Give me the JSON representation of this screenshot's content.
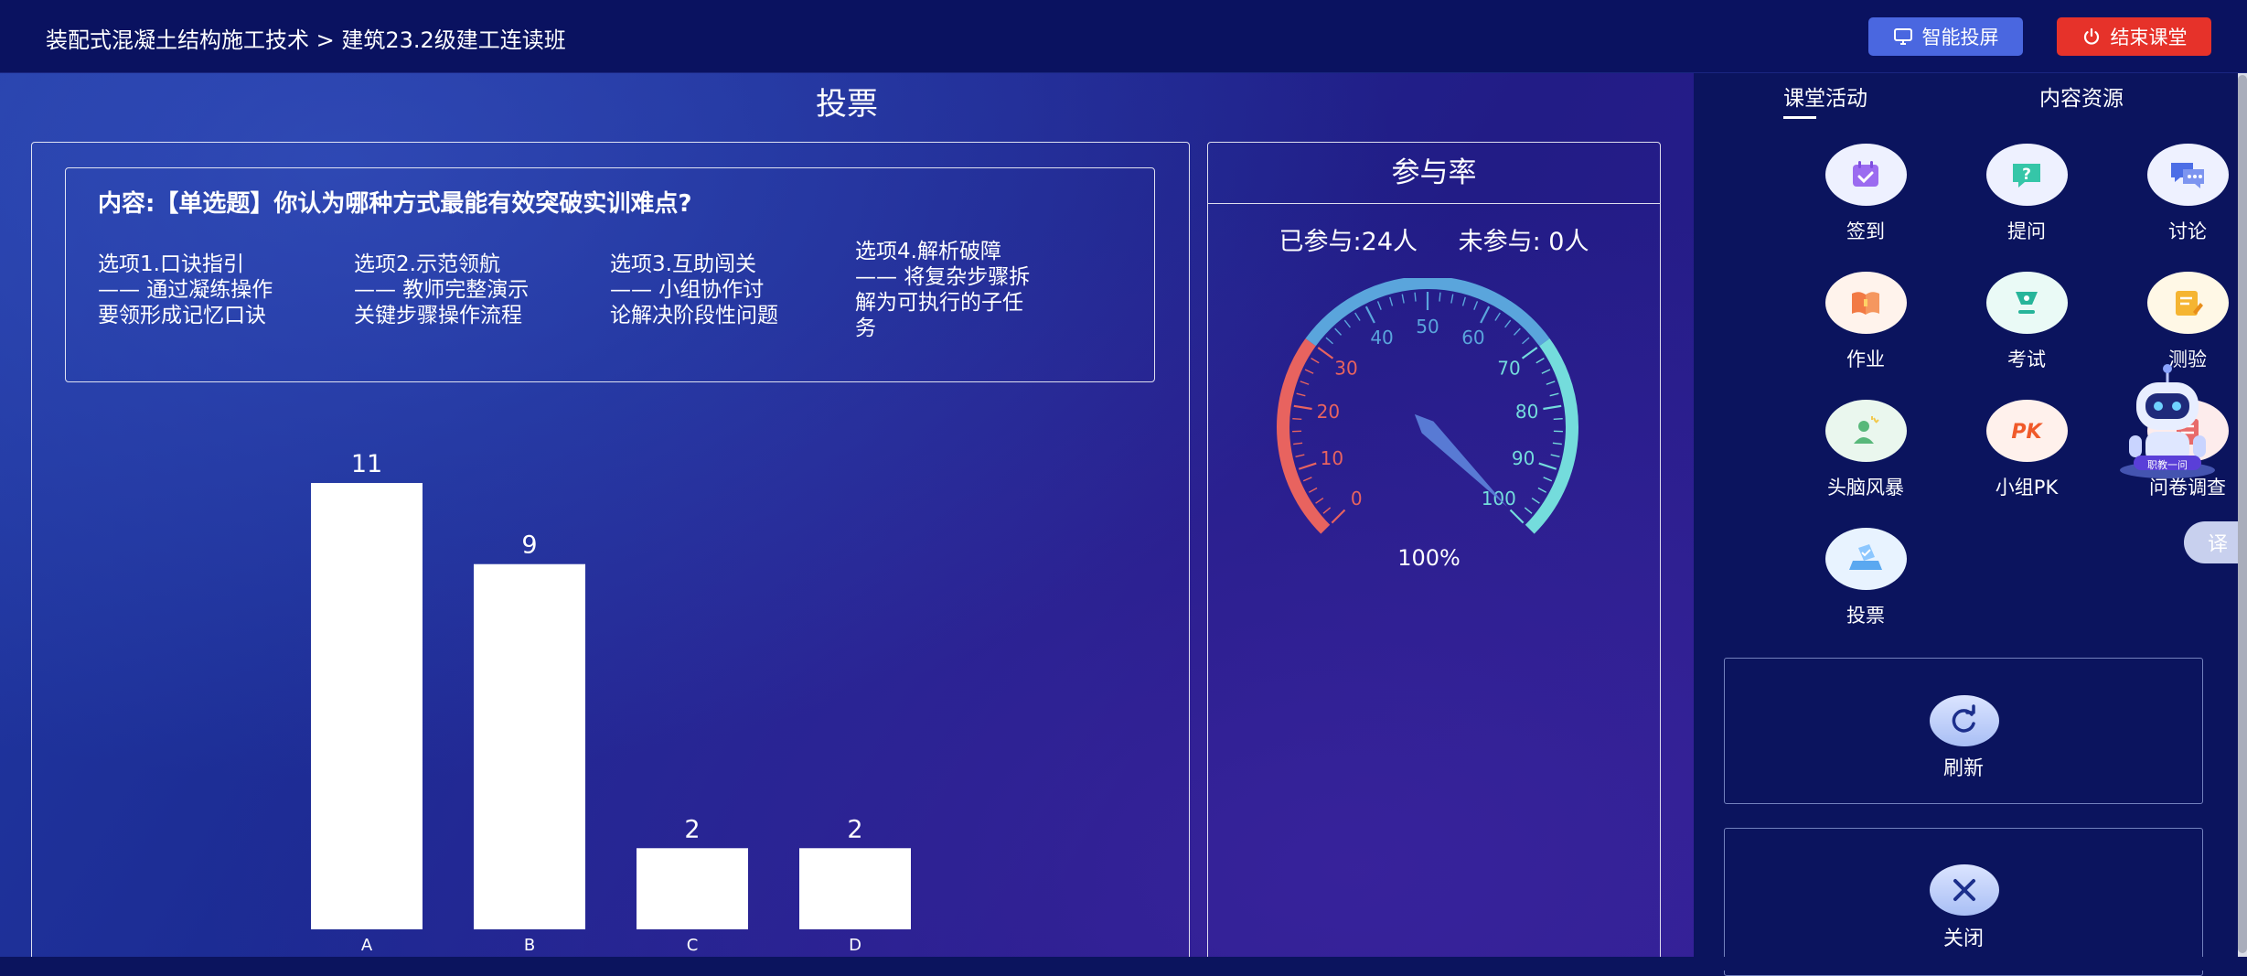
{
  "header": {
    "breadcrumb": "装配式混凝土结构施工技术 > 建筑23.2级建工连读班",
    "smart_screen_label": "智能投屏",
    "end_class_label": "结束课堂"
  },
  "vote": {
    "title": "投票",
    "question": "内容:【单选题】你认为哪种方式最能有效突破实训难点?",
    "options": [
      {
        "lines": [
          "选项1.口诀指引",
          "—— 通过凝练操作",
          "要领形成记忆口诀"
        ]
      },
      {
        "lines": [
          "选项2.示范领航",
          "—— 教师完整演示",
          "关键步骤操作流程"
        ]
      },
      {
        "lines": [
          "选项3.互助闯关",
          "—— 小组协作讨",
          "论解决阶段性问题"
        ]
      },
      {
        "lines": [
          "选项4.解析破障",
          "—— 将复杂步骤拆",
          "解为可执行的子任",
          "务"
        ]
      }
    ]
  },
  "chart_data": {
    "type": "bar",
    "categories": [
      "A",
      "B",
      "C",
      "D"
    ],
    "values": [
      11,
      9,
      2,
      2
    ],
    "title": "",
    "xlabel": "",
    "ylabel": "",
    "ylim": [
      0,
      11
    ],
    "bar_color": "#ffffff",
    "grid": false
  },
  "participation": {
    "title": "参与率",
    "participated_label": "已参与:24人",
    "not_participated_label": "未参与: 0人",
    "rate_value": 100,
    "rate_text": "100%",
    "gauge_ticks": [
      "0",
      "10",
      "20",
      "30",
      "40",
      "50",
      "60",
      "70",
      "80",
      "90",
      "100"
    ],
    "colors": {
      "low": "#e8635f",
      "mid": "#5aa5dc",
      "high": "#74dcdc"
    }
  },
  "sidebar": {
    "tabs": [
      "课堂活动",
      "内容资源"
    ],
    "activities": [
      {
        "label": "签到",
        "icon": "checkin-icon"
      },
      {
        "label": "提问",
        "icon": "question-icon"
      },
      {
        "label": "讨论",
        "icon": "discussion-icon"
      },
      {
        "label": "作业",
        "icon": "homework-icon"
      },
      {
        "label": "考试",
        "icon": "exam-icon"
      },
      {
        "label": "测验",
        "icon": "quiz-icon"
      },
      {
        "label": "头脑风暴",
        "icon": "brainstorm-icon"
      },
      {
        "label": "小组PK",
        "icon": "group-pk-icon"
      },
      {
        "label": "问卷调查",
        "icon": "survey-icon"
      },
      {
        "label": "投票",
        "icon": "vote-icon"
      }
    ],
    "refresh_label": "刷新",
    "close_label": "关闭",
    "robot_badge": "职教一问",
    "translate_label": "译"
  }
}
